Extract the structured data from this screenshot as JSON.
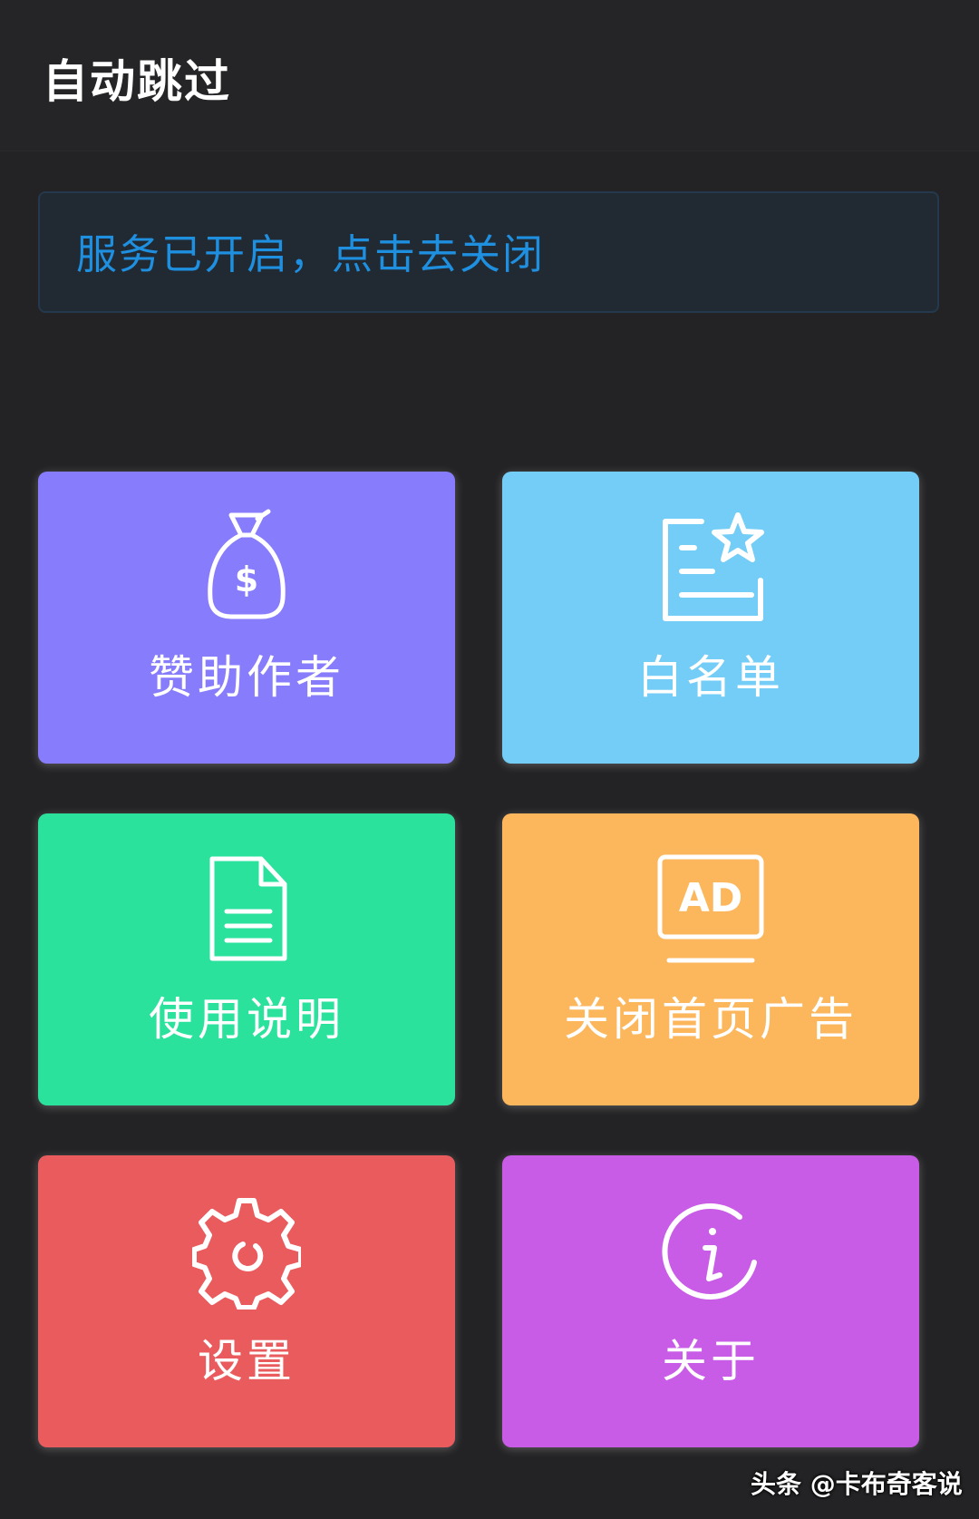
{
  "header": {
    "title": "自动跳过"
  },
  "service": {
    "status_text": "服务已开启，点击去关闭",
    "color": "#1f8fe0"
  },
  "tiles": [
    {
      "label": "赞助作者",
      "icon": "money-bag-icon",
      "color": "#877cfb"
    },
    {
      "label": "白名单",
      "icon": "whitelist-star-icon",
      "color": "#73cdf6"
    },
    {
      "label": "使用说明",
      "icon": "document-icon",
      "color": "#2ae29c"
    },
    {
      "label": "关闭首页广告",
      "icon": "ad-icon",
      "ad_text": "AD",
      "color": "#fcb75d"
    },
    {
      "label": "设置",
      "icon": "gear-icon",
      "color": "#ea5b5e"
    },
    {
      "label": "关于",
      "icon": "info-icon",
      "color": "#c95ce7"
    }
  ],
  "watermark": {
    "text": "头条 @卡布奇客说"
  }
}
